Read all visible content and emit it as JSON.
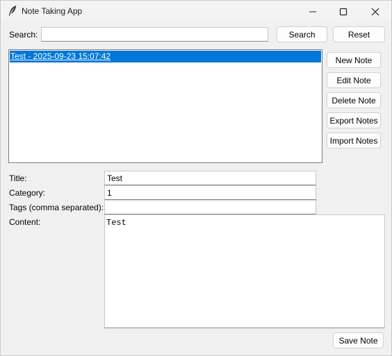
{
  "window": {
    "title": "Note Taking App"
  },
  "search": {
    "label": "Search:",
    "value": "",
    "search_button": "Search",
    "reset_button": "Reset"
  },
  "notes_list": {
    "items": [
      {
        "label": "Test - 2025-09-23 15:07:42",
        "selected": true
      }
    ]
  },
  "actions": {
    "new_note": "New Note",
    "edit_note": "Edit Note",
    "delete_note": "Delete Note",
    "export_notes": "Export Notes",
    "import_notes": "Import Notes"
  },
  "form": {
    "title_label": "Title:",
    "title_value": "Test",
    "category_label": "Category:",
    "category_value": "1",
    "tags_label": "Tags (comma separated):",
    "tags_value": "",
    "content_label": "Content:",
    "content_value": "Test",
    "save_button": "Save Note"
  },
  "colors": {
    "selection": "#0078d7",
    "window_bg": "#f0f0f0"
  }
}
